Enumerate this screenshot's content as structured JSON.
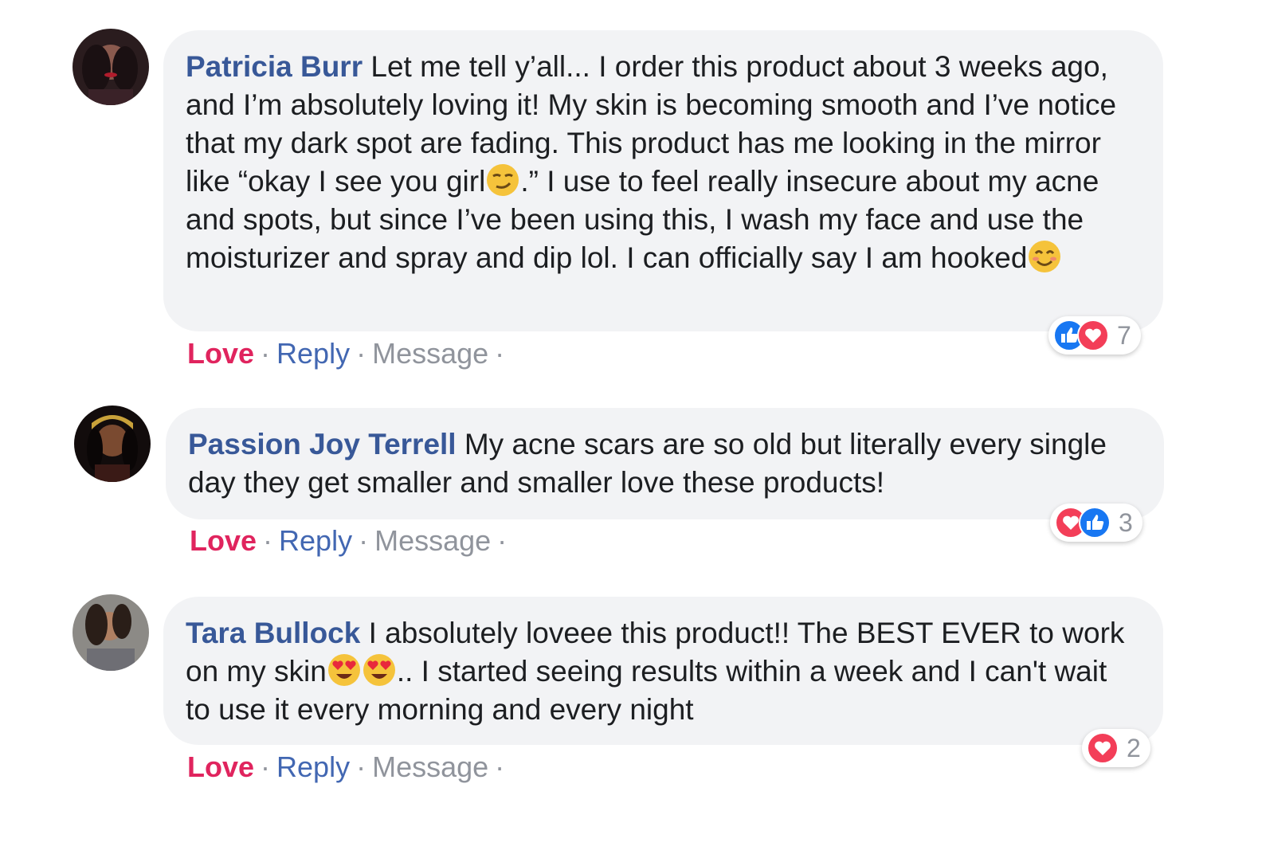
{
  "comments": [
    {
      "author": "Patricia Burr",
      "text_parts": [
        "Let me tell y’all... I order this product about 3 weeks ago, and I’m absolutely loving it! My skin is becoming smooth and I’ve notice that my dark spot are fading. This product has me looking in the mirror like “okay I see you girl",
        ".” I use to feel really insecure about my acne and spots, but since I’ve been using this, I wash my face and use the moisturizer and spray and dip lol. I can officially say I am hooked"
      ],
      "emojis": [
        "smirk-emoji",
        "smiling-emoji"
      ],
      "actions": {
        "love": "Love",
        "reply": "Reply",
        "message": "Message"
      },
      "reactions": {
        "icons": [
          "like-icon",
          "love-icon"
        ],
        "count": "7"
      }
    },
    {
      "author": "Passion Joy Terrell",
      "text": "My acne scars are so old but literally every single day they get smaller and smaller love these products!",
      "actions": {
        "love": "Love",
        "reply": "Reply",
        "message": "Message"
      },
      "reactions": {
        "icons": [
          "love-icon",
          "like-icon"
        ],
        "count": "3"
      }
    },
    {
      "author": "Tara Bullock",
      "text_parts": [
        "I absolutely loveee this product!! The BEST EVER to work on my skin",
        ".. I started seeing results within a week and I can't wait to use it every morning and every night"
      ],
      "emojis": [
        "heart-eyes-emoji",
        "heart-eyes-emoji"
      ],
      "actions": {
        "love": "Love",
        "reply": "Reply",
        "message": "Message"
      },
      "reactions": {
        "icons": [
          "love-icon"
        ],
        "count": "2"
      }
    }
  ],
  "colors": {
    "author": "#385898",
    "love": "#e0245e",
    "reply": "#4267b2",
    "message": "#90949c",
    "bubble": "#f2f3f5",
    "like_reaction": "#1877f2",
    "love_reaction": "#f33e58"
  }
}
